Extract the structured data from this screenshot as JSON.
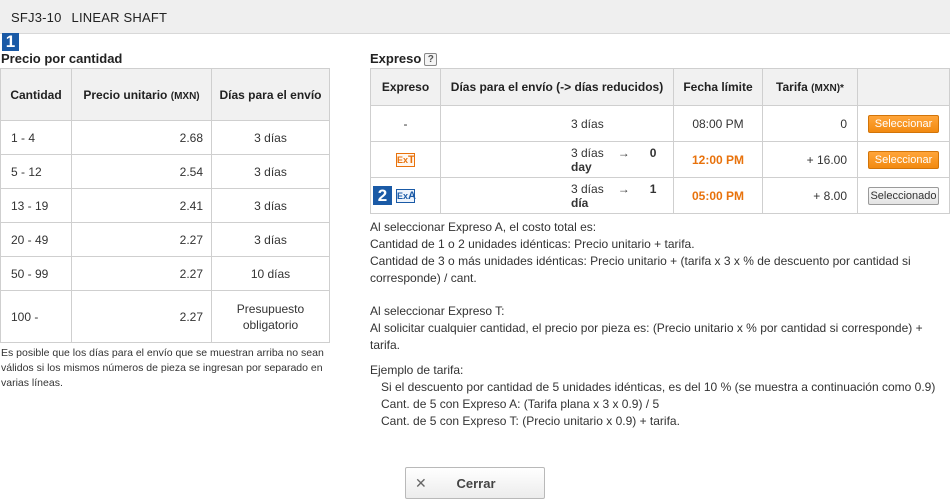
{
  "header": {
    "part_number": "SFJ3-10",
    "product_name": "LINEAR SHAFT"
  },
  "step1": "1",
  "step2": "2",
  "quantity_pricing": {
    "title": "Precio por cantidad",
    "headers": {
      "quantity": "Cantidad",
      "unit_price": "Precio unitario",
      "unit_price_currency": "(MXN)",
      "ship_days": "Días para el envío"
    },
    "rows": [
      {
        "qty": "1 - 4",
        "price": "2.68",
        "days": "3 días"
      },
      {
        "qty": "5 - 12",
        "price": "2.54",
        "days": "3 días"
      },
      {
        "qty": "13 - 19",
        "price": "2.41",
        "days": "3 días"
      },
      {
        "qty": "20 - 49",
        "price": "2.27",
        "days": "3 días"
      },
      {
        "qty": "50 - 99",
        "price": "2.27",
        "days": "10 días"
      },
      {
        "qty": "100 -",
        "price": "2.27",
        "days": "Presupuesto obligatorio"
      }
    ],
    "footnote": "Es posible que los días para el envío que se muestran arriba no sean válidos si los mismos números de pieza se ingresan por separado en varias líneas."
  },
  "express": {
    "title": "Expreso",
    "help_icon": "?",
    "headers": {
      "express": "Expreso",
      "days": "Días para el envío (-> días reducidos)",
      "deadline": "Fecha límite",
      "rate": "Tarifa",
      "rate_currency": "(MXN)*"
    },
    "rows": [
      {
        "icon": "-",
        "days": "3 días",
        "arrow": "",
        "reduced": "",
        "deadline": "08:00 PM",
        "rate": "0",
        "button": "Seleccionar"
      },
      {
        "icon_prefix": "Ex",
        "icon_letter": "T",
        "days": "3 días",
        "arrow": "→",
        "reduced": "0 day",
        "deadline": "12:00 PM",
        "rate": "+ 16.00",
        "button": "Seleccionar"
      },
      {
        "icon_prefix": "Ex",
        "icon_letter": "A",
        "days": "3 días",
        "arrow": "→",
        "reduced": "1 día",
        "deadline": "05:00 PM",
        "rate": "+ 8.00",
        "button": "Seleccionado"
      }
    ]
  },
  "info": {
    "a_lines": [
      "Al seleccionar Expreso A, el costo total es:",
      "Cantidad de 1 o 2 unidades idénticas: Precio unitario + tarifa.",
      "Cantidad de 3 o más unidades idénticas: Precio unitario + (tarifa x 3 x % de descuento por cantidad si corresponde) / cant."
    ],
    "t_lines": [
      "Al seleccionar Expreso T:",
      "Al solicitar cualquier cantidad, el precio por pieza es: (Precio unitario x % por cantidad si corresponde) + tarifa."
    ],
    "example_title": "Ejemplo de tarifa:",
    "example_lines": [
      "Si el descuento por cantidad de 5 unidades idénticas, es del 10 % (se muestra a continuación como 0.9)",
      "Cant. de 5 con Expreso A: (Tarifa plana x 3 x 0.9) / 5",
      "Cant. de 5 con Expreso T: (Precio unitario x 0.9) + tarifa."
    ]
  },
  "close_button": {
    "icon": "✕",
    "label": "Cerrar"
  }
}
